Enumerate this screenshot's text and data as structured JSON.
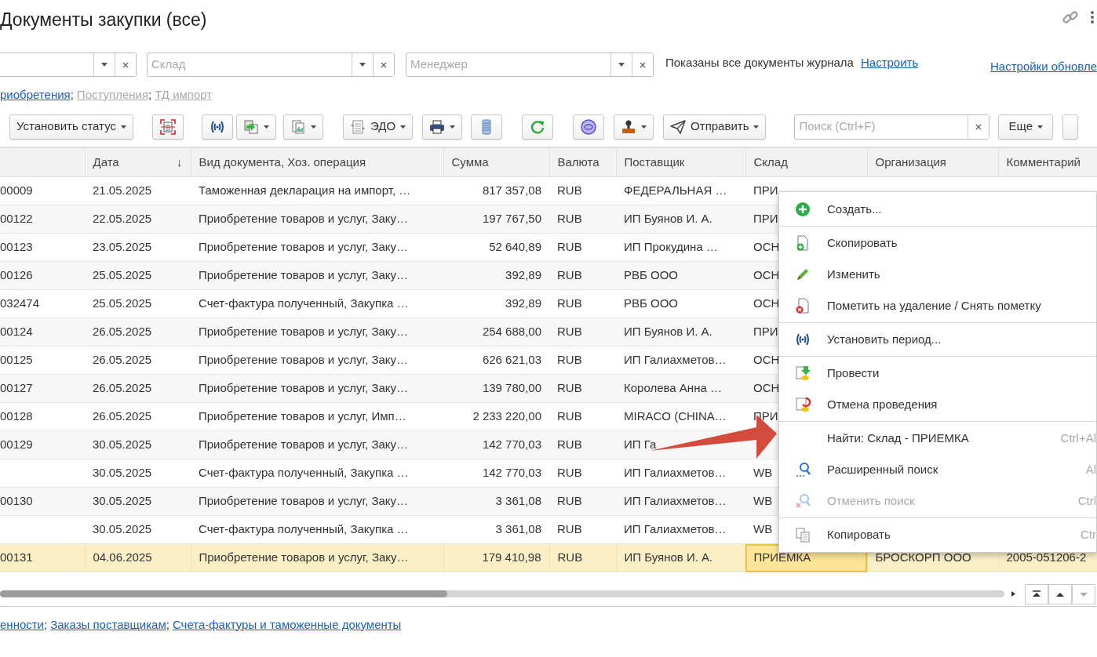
{
  "window": {
    "title": "Документы закупки (все)"
  },
  "filters": [
    {
      "placeholder": "Склад"
    },
    {
      "placeholder": "Менеджер"
    }
  ],
  "filter_status": "Показаны все документы журнала",
  "filter_link": "Настроить",
  "refresh_settings_link": "Настройки обновле",
  "link_separator": ";",
  "doc_types": [
    {
      "label": "риобретения",
      "active": true
    },
    {
      "label": "Поступления",
      "active": false
    },
    {
      "label": "ТД импорт",
      "active": false
    }
  ],
  "toolbar": [
    {
      "label": "Установить статус",
      "dropdown": true
    },
    {
      "dropdown": false
    },
    {
      "dropdown": false
    },
    {
      "dropdown": true
    },
    {
      "dropdown": true
    },
    {
      "label": "ЭДО",
      "dropdown": true
    },
    {
      "dropdown": true
    },
    {
      "dropdown": false
    },
    {
      "dropdown": false
    },
    {
      "dropdown": false
    },
    {
      "dropdown": true
    },
    {
      "label": "Отправить",
      "dropdown": true
    }
  ],
  "search": {
    "placeholder": "Поиск (Ctrl+F)"
  },
  "more_button": {
    "label": "Еще",
    "dropdown": true
  },
  "table": {
    "columns": [
      null,
      {
        "label": "Дата",
        "sort": "↓"
      },
      {
        "label": "Вид документа, Хоз. операция"
      },
      {
        "label": "Сумма"
      },
      {
        "label": "Валюта"
      },
      {
        "label": "Поставщик"
      },
      {
        "label": "Склад"
      },
      {
        "label": "Организация"
      },
      {
        "label": "Комментарий"
      }
    ],
    "rows": [
      {
        "cells": [
          "00009",
          "21.05.2025",
          "Таможенная декларация на импорт, …",
          "817 357,08",
          "RUB",
          "ФЕДЕРАЛЬНАЯ …",
          "ПРИ",
          null,
          null
        ],
        "selected": false
      },
      {
        "cells": [
          "00122",
          "22.05.2025",
          "Приобретение товаров и услуг, Заку…",
          "197 767,50",
          "RUB",
          "ИП Буянов И. А.",
          "ПРИ",
          null,
          null
        ],
        "selected": false
      },
      {
        "cells": [
          "00123",
          "23.05.2025",
          "Приобретение товаров и услуг, Заку…",
          "52 640,89",
          "RUB",
          "ИП Прокудина …",
          "ОСН",
          null,
          null
        ],
        "selected": false
      },
      {
        "cells": [
          "00126",
          "25.05.2025",
          "Приобретение товаров и услуг, Заку…",
          "392,89",
          "RUB",
          "РВБ ООО",
          "ОСН",
          null,
          null
        ],
        "selected": false
      },
      {
        "cells": [
          "032474",
          "25.05.2025",
          "Счет-фактура полученный, Закупка …",
          "392,89",
          "RUB",
          "РВБ ООО",
          "ОСН",
          null,
          null
        ],
        "selected": false
      },
      {
        "cells": [
          "00124",
          "26.05.2025",
          "Приобретение товаров и услуг, Заку…",
          "254 688,00",
          "RUB",
          "ИП Буянов И. А.",
          "ПРИ",
          null,
          null
        ],
        "selected": false
      },
      {
        "cells": [
          "00125",
          "26.05.2025",
          "Приобретение товаров и услуг, Заку…",
          "626 621,03",
          "RUB",
          "ИП Галиахметов…",
          "ОСН",
          null,
          null
        ],
        "selected": false
      },
      {
        "cells": [
          "00127",
          "26.05.2025",
          "Приобретение товаров и услуг, Заку…",
          "139 780,00",
          "RUB",
          "Королева Анна …",
          "ОСН",
          null,
          null
        ],
        "selected": false
      },
      {
        "cells": [
          "00128",
          "26.05.2025",
          "Приобретение товаров и услуг, Имп…",
          "2 233 220,00",
          "RUB",
          "MIRACO (CHINA…",
          "ПРИ",
          null,
          null
        ],
        "selected": false
      },
      {
        "cells": [
          "00129",
          "30.05.2025",
          "Приобретение товаров и услуг, Заку…",
          "142 770,03",
          "RUB",
          "ИП Га",
          null,
          null,
          null
        ],
        "selected": false
      },
      {
        "cells": [
          null,
          "30.05.2025",
          "Счет-фактура полученный, Закупка …",
          "142 770,03",
          "RUB",
          "ИП Галиахметов…",
          "WB",
          null,
          null
        ],
        "selected": false
      },
      {
        "cells": [
          "00130",
          "30.05.2025",
          "Приобретение товаров и услуг, Заку…",
          "3 361,08",
          "RUB",
          "ИП Галиахметов…",
          "WB",
          null,
          null
        ],
        "selected": false
      },
      {
        "cells": [
          null,
          "30.05.2025",
          "Счет-фактура полученный, Закупка …",
          "3 361,08",
          "RUB",
          "ИП Галиахметов…",
          "WB",
          null,
          null
        ],
        "selected": false
      },
      {
        "cells": [
          "00131",
          "04.06.2025",
          "Приобретение товаров и услуг, Заку…",
          "179 410,98",
          "RUB",
          "ИП Буянов И. А.",
          {
            "text": "ПРИЕМКА",
            "focused": true
          },
          "БРОСКОРП ООО",
          "2005-051206-2"
        ],
        "selected": true
      }
    ]
  },
  "context_menu": {
    "groups": [
      [
        {
          "label": "Создать...",
          "disabled": false
        }
      ],
      [
        {
          "label": "Скопировать",
          "disabled": false
        },
        {
          "label": "Изменить",
          "disabled": false
        },
        {
          "label": "Пометить на удаление / Снять пометку",
          "disabled": false
        }
      ],
      [
        {
          "label": "Установить период...",
          "disabled": false
        }
      ],
      [
        {
          "label": "Провести",
          "disabled": false
        },
        {
          "label": "Отмена проведения",
          "disabled": false
        }
      ],
      [
        {
          "label": "Найти: Склад - ПРИЕМКА",
          "shortcut": "Ctrl+Al",
          "disabled": false
        },
        {
          "label": "Расширенный поиск",
          "shortcut": "Al",
          "disabled": false
        },
        {
          "label": "Отменить поиск",
          "shortcut": "Ctrl",
          "disabled": true
        }
      ],
      [
        {
          "label": "Копировать",
          "shortcut": "Ctr",
          "disabled": false
        }
      ]
    ]
  },
  "bottom_links": [
    "енности",
    "Заказы поставщикам",
    "Счета-фактуры и таможенные документы"
  ]
}
